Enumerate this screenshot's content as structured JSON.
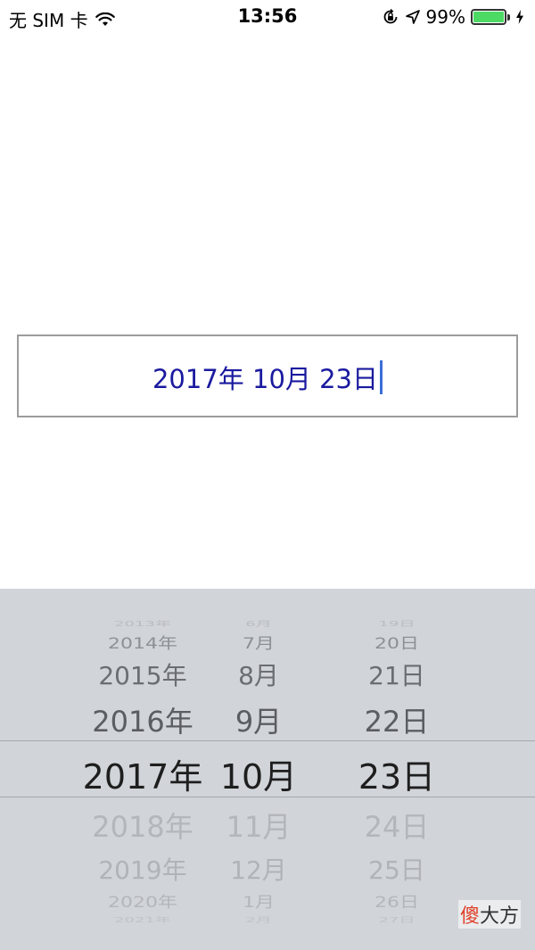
{
  "status_bar": {
    "carrier": "无 SIM 卡",
    "time": "13:56",
    "battery_percent": "99%",
    "battery_level": 0.99,
    "icons": [
      "wifi-icon",
      "orientation-lock-icon",
      "location-arrow-icon",
      "battery-icon",
      "charging-bolt-icon"
    ],
    "battery_color": "#4cd964"
  },
  "date_field": {
    "value": "2017年 10月 23日",
    "text_color": "#1a1aa0"
  },
  "picker": {
    "years": [
      "2013年",
      "2014年",
      "2015年",
      "2016年",
      "2017年",
      "2018年",
      "2019年",
      "2020年",
      "2021年"
    ],
    "months": [
      "6月",
      "7月",
      "8月",
      "9月",
      "10月",
      "11月",
      "12月",
      "1月",
      "2月"
    ],
    "days": [
      "19日",
      "20日",
      "21日",
      "22日",
      "23日",
      "24日",
      "25日",
      "26日",
      "27日"
    ],
    "selected": {
      "year": "2017年",
      "month": "10月",
      "day": "23日"
    },
    "background": "#d1d4d9"
  },
  "watermark": {
    "accent_char": "傻",
    "rest": "大方"
  }
}
